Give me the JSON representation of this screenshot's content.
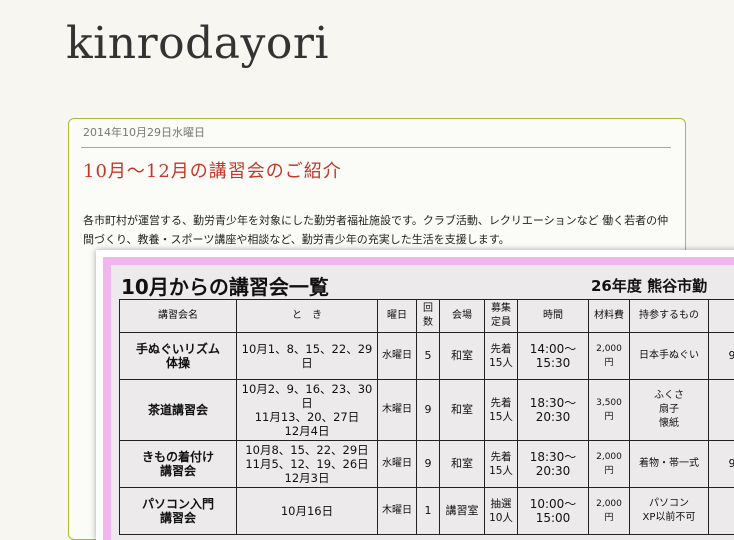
{
  "blog": {
    "title": "kinrodayori"
  },
  "post": {
    "date": "2014年10月29日水曜日",
    "title": "10月～12月の講習会のご紹介",
    "body": "各市町村が運営する、勤労青少年を対象にした勤労者福祉施設です。クラブ活動、レクリエーションなど 働く若者の仲間づくり、教養・スポーツ講座や相談など、勤労青少年の充実した生活を支援します。"
  },
  "scan": {
    "heading": "10月からの講習会一覧",
    "year_label": "26年度 熊谷市勤",
    "headers": [
      "講習会名",
      "と　き",
      "曜日",
      "回数",
      "会場",
      "募集\n定員",
      "時間",
      "材料費",
      "持参するもの",
      ""
    ],
    "rows": [
      {
        "name": "手ぬぐいリズム\n体操",
        "dates": "10月1、8、15、22、29\n日",
        "day": "水曜日",
        "count": "5",
        "place": "和室",
        "capacity": "先着\n15人",
        "time": "14:00～\n15:30",
        "fee": "2,000円",
        "items": "日本手ぬぐい",
        "extra": "9"
      },
      {
        "name": "茶道講習会",
        "dates": "10月2、9、16、23、30日\n11月13、20、27日\n12月4日",
        "day": "木曜日",
        "count": "9",
        "place": "和室",
        "capacity": "先着\n15人",
        "time": "18:30～\n20:30",
        "fee": "3,500円",
        "items": "ふくさ\n扇子\n懐紙",
        "extra": ""
      },
      {
        "name": "きもの着付け\n講習会",
        "dates": "10月8、15、22、29日\n11月5、12、19、26日\n12月3日",
        "day": "水曜日",
        "count": "9",
        "place": "和室",
        "capacity": "先着\n15人",
        "time": "18:30～\n20:30",
        "fee": "2,000円",
        "items": "着物・帯一式",
        "extra": "9"
      },
      {
        "name": "パソコン入門\n講習会",
        "dates": "10月16日",
        "day": "木曜日",
        "count": "1",
        "place": "講習室",
        "capacity": "抽選\n10人",
        "time": "10:00～\n15:00",
        "fee": "2,000円",
        "items": "パソコン\nXP以前不可",
        "extra": ""
      }
    ]
  }
}
